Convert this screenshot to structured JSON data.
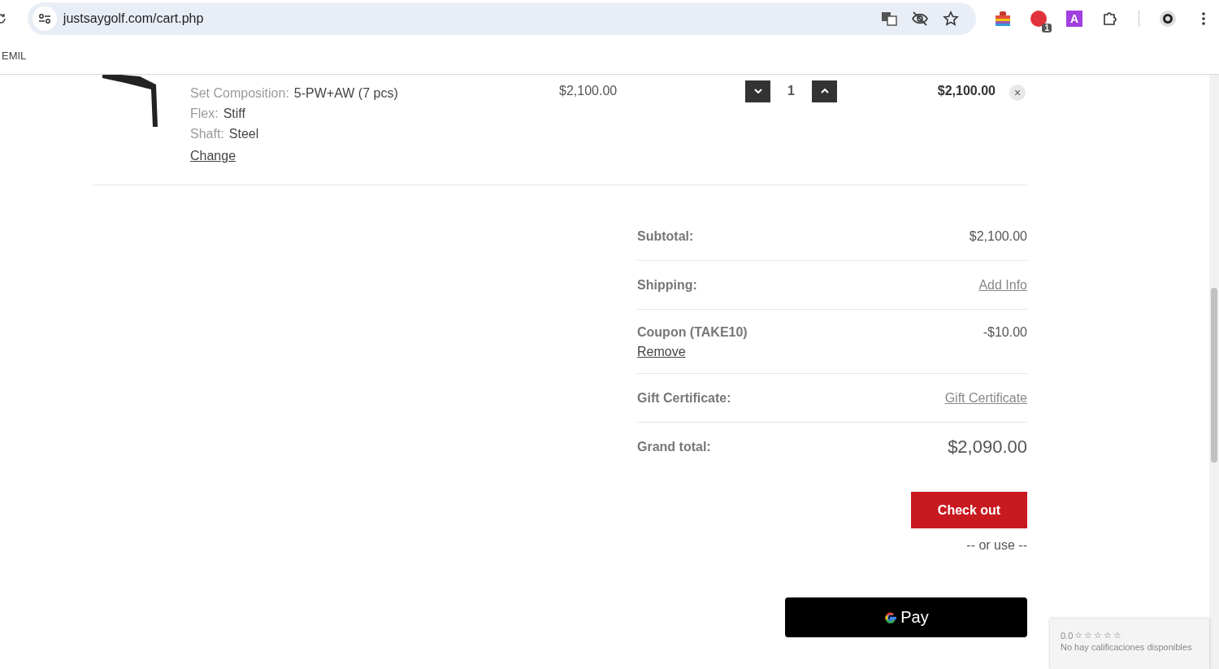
{
  "browser": {
    "url": "justsaygolf.com/cart.php",
    "extension_badge": "1",
    "extension_letter": "A",
    "bookmark": "EMIL"
  },
  "cart_item": {
    "options": [
      {
        "label": "Set Composition:",
        "value": "5-PW+AW (7 pcs)"
      },
      {
        "label": "Flex:",
        "value": "Stiff"
      },
      {
        "label": "Shaft:",
        "value": "Steel"
      }
    ],
    "change_link": "Change",
    "price": "$2,100.00",
    "quantity": "1",
    "total": "$2,100.00",
    "remove": "×"
  },
  "totals": [
    {
      "label": "Subtotal:",
      "value": "$2,100.00",
      "kind": "text"
    },
    {
      "label": "Shipping:",
      "value": "Add Info",
      "kind": "link"
    },
    {
      "label": "Coupon (TAKE10)",
      "value": "-$10.00",
      "kind": "coupon",
      "action": "Remove"
    },
    {
      "label": "Gift Certificate:",
      "value": "Gift Certificate",
      "kind": "link"
    },
    {
      "label": "Grand total:",
      "value": "$2,090.00",
      "kind": "grand"
    }
  ],
  "checkout_button": "Check out",
  "or_use": "-- or use --",
  "gpay_button": "Pay",
  "rating_widget": {
    "score": "0.0",
    "stars": 0,
    "message": "No hay calificaciones disponibles"
  }
}
